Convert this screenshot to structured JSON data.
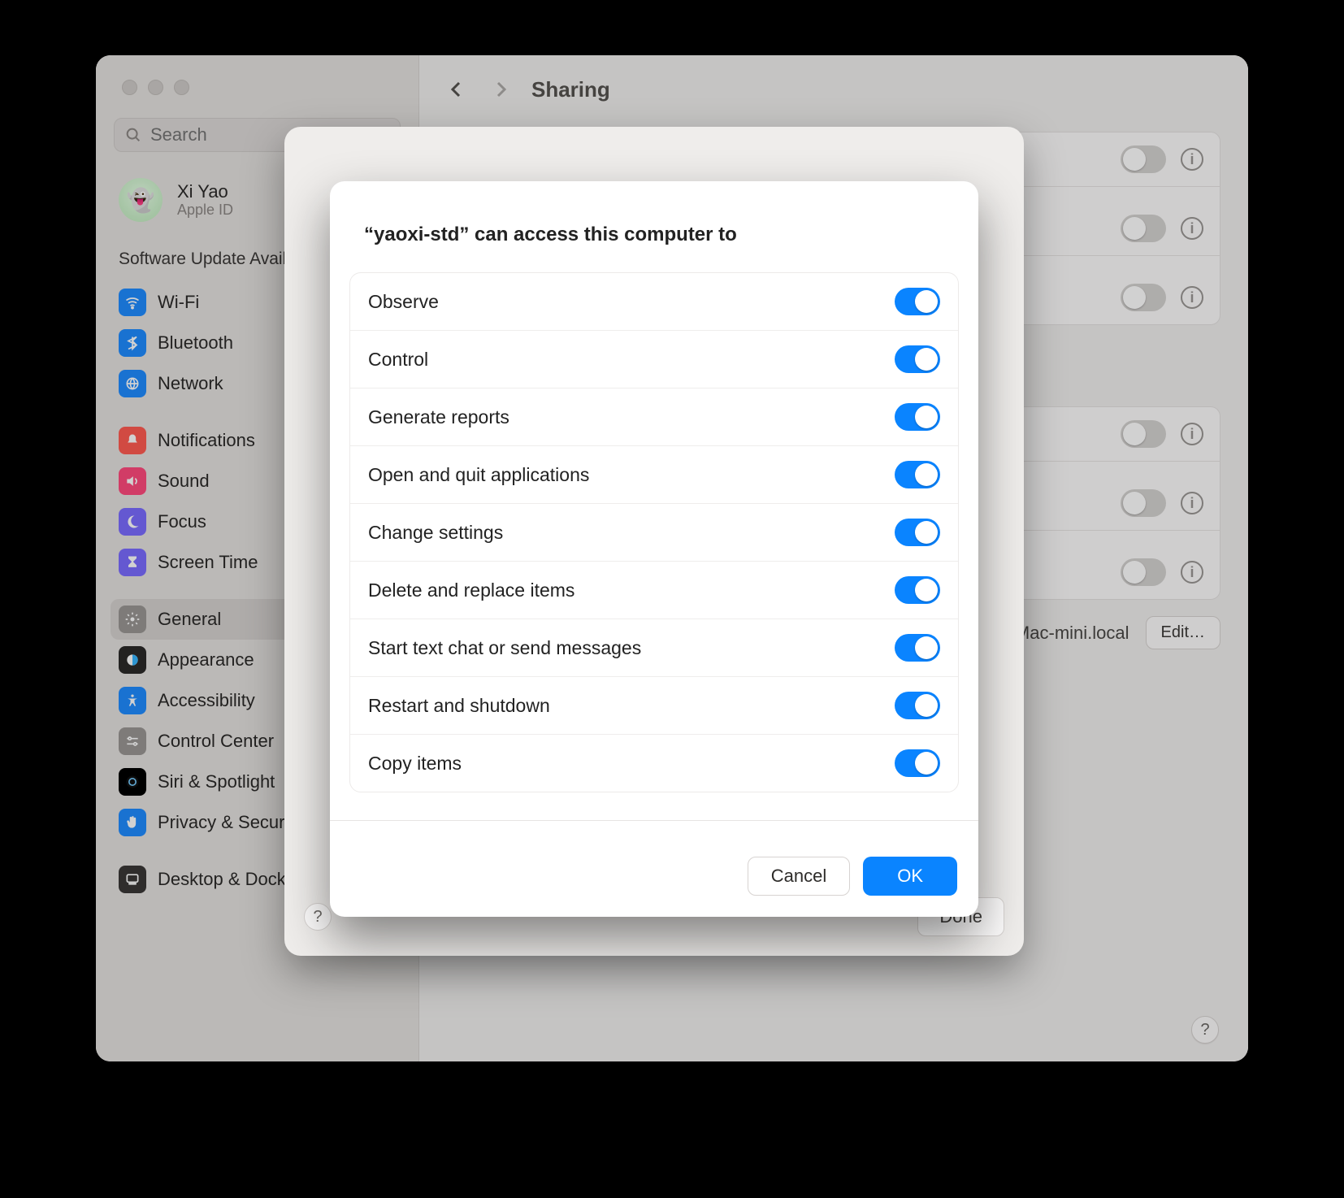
{
  "window": {
    "page_title": "Sharing",
    "search_placeholder": "Search",
    "account": {
      "name": "Xi Yao",
      "sub": "Apple ID"
    },
    "section": "Software Update Available",
    "hostname": "-Mac-mini.local",
    "edit_label": "Edit…",
    "done_label": "Done"
  },
  "sidebar": {
    "groups": [
      [
        {
          "label": "Wi-Fi",
          "color": "#1f8bff",
          "glyph": "wifi"
        },
        {
          "label": "Bluetooth",
          "color": "#1f8bff",
          "glyph": "bt"
        },
        {
          "label": "Network",
          "color": "#1f8bff",
          "glyph": "globe"
        }
      ],
      [
        {
          "label": "Notifications",
          "color": "#ff5b51",
          "glyph": "bell"
        },
        {
          "label": "Sound",
          "color": "#ff4a7d",
          "glyph": "sound"
        },
        {
          "label": "Focus",
          "color": "#7a6cff",
          "glyph": "moon"
        },
        {
          "label": "Screen Time",
          "color": "#7a6cff",
          "glyph": "hourglass"
        }
      ],
      [
        {
          "label": "General",
          "color": "#9a9794",
          "glyph": "gear",
          "selected": true
        },
        {
          "label": "Appearance",
          "color": "#2b2a29",
          "glyph": "appearance"
        },
        {
          "label": "Accessibility",
          "color": "#1f8bff",
          "glyph": "access"
        },
        {
          "label": "Control Center",
          "color": "#9a9794",
          "glyph": "cc"
        },
        {
          "label": "Siri & Spotlight",
          "color": "#000",
          "glyph": "siri"
        },
        {
          "label": "Privacy & Security",
          "color": "#1f8bff",
          "glyph": "hand"
        }
      ],
      [
        {
          "label": "Desktop & Dock",
          "color": "#3a3836",
          "glyph": "dock"
        }
      ]
    ]
  },
  "bg_toggles": [
    {
      "on": false
    },
    {
      "on": false
    },
    {
      "on": false
    },
    {
      "on": false
    },
    {
      "on": false
    },
    {
      "on": false
    }
  ],
  "perm": {
    "title": "“yaoxi-std” can access this computer to",
    "items": [
      {
        "label": "Observe",
        "on": true
      },
      {
        "label": "Control",
        "on": true
      },
      {
        "label": "Generate reports",
        "on": true
      },
      {
        "label": "Open and quit applications",
        "on": true
      },
      {
        "label": "Change settings",
        "on": true
      },
      {
        "label": "Delete and replace items",
        "on": true
      },
      {
        "label": "Start text chat or send messages",
        "on": true
      },
      {
        "label": "Restart and shutdown",
        "on": true
      },
      {
        "label": "Copy items",
        "on": true
      }
    ],
    "cancel": "Cancel",
    "ok": "OK"
  }
}
